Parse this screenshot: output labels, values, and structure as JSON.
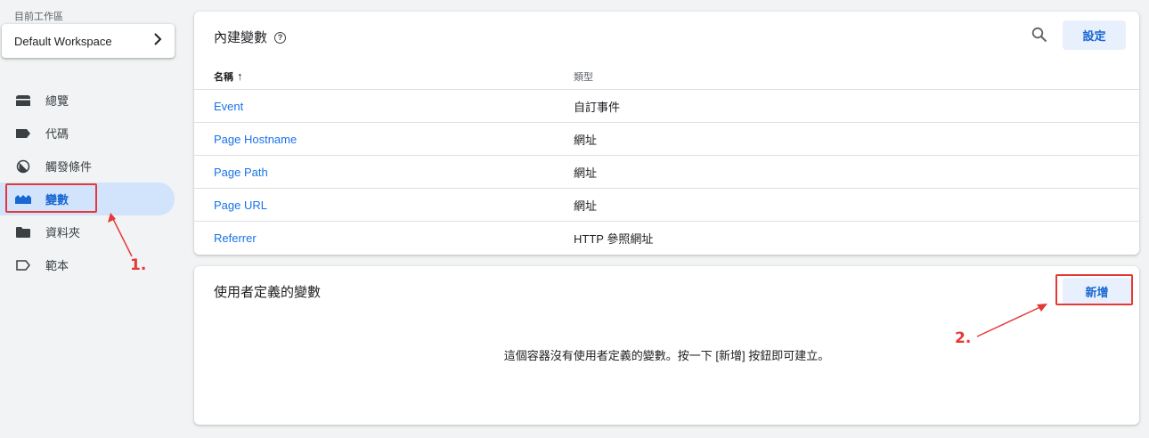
{
  "sidebar": {
    "workspace_label": "目前工作區",
    "workspace_name": "Default Workspace",
    "items": [
      {
        "label": "總覽",
        "icon": "overview-icon"
      },
      {
        "label": "代碼",
        "icon": "tag-icon"
      },
      {
        "label": "觸發條件",
        "icon": "trigger-icon"
      },
      {
        "label": "變數",
        "icon": "variables-icon",
        "active": true
      },
      {
        "label": "資料夾",
        "icon": "folder-icon"
      },
      {
        "label": "範本",
        "icon": "template-icon"
      }
    ]
  },
  "builtin": {
    "title": "內建變數",
    "settings_label": "設定",
    "columns": {
      "name": "名稱",
      "type": "類型"
    },
    "rows": [
      {
        "name": "Event",
        "type": "自訂事件"
      },
      {
        "name": "Page Hostname",
        "type": "網址"
      },
      {
        "name": "Page Path",
        "type": "網址"
      },
      {
        "name": "Page URL",
        "type": "網址"
      },
      {
        "name": "Referrer",
        "type": "HTTP 參照網址"
      }
    ]
  },
  "user_defined": {
    "title": "使用者定義的變數",
    "new_label": "新增",
    "empty_text": "這個容器沒有使用者定義的變數。按一下 [新增] 按鈕即可建立。"
  },
  "annotations": {
    "step1": "1.",
    "step2": "2."
  },
  "colors": {
    "accent": "#1a73e8",
    "active_bg": "#d2e3fc",
    "annotation": "#e53935"
  }
}
